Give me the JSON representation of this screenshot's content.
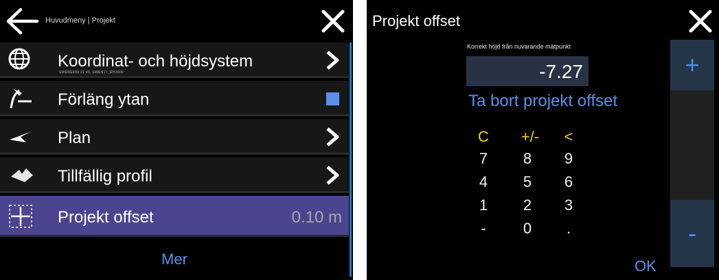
{
  "menu_screen": {
    "breadcrumb": "Huvudmeny | Projekt",
    "items": [
      {
        "label": "Koordinat- och höjdsystem",
        "sublabel": "SWEREF99 21 45, SWEN17_RH2000",
        "icon": "globe-icon",
        "control": "chevron"
      },
      {
        "label": "Förläng ytan",
        "icon": "extend-surface-icon",
        "control": "checkbox",
        "checked": true
      },
      {
        "label": "Plan",
        "icon": "plane-icon",
        "control": "chevron"
      },
      {
        "label": "Tillfällig profil",
        "icon": "profile-icon",
        "control": "chevron"
      },
      {
        "label": "Projekt offset",
        "icon": "offset-icon",
        "control": "value",
        "value": "0.10 m",
        "selected": true
      }
    ],
    "more_label": "Mer"
  },
  "offset_dialog": {
    "title": "Projekt offset",
    "caption": "Korrekt höjd från nuvarande mätpunkt",
    "value": "-7.27",
    "remove_label": "Ta bort projekt offset",
    "keypad": {
      "func": [
        "C",
        "+/-",
        "<"
      ],
      "rows": [
        [
          "7",
          "8",
          "9"
        ],
        [
          "4",
          "5",
          "6"
        ],
        [
          "1",
          "2",
          "3"
        ],
        [
          "-",
          "0",
          "."
        ]
      ]
    },
    "plus_label": "+",
    "minus_label": "-",
    "ok_label": "OK"
  },
  "colors": {
    "accent_blue": "#5b8fea",
    "selected_row": "#4b4590",
    "keypad_function": "#e8d22a",
    "row_background": "#171717"
  }
}
